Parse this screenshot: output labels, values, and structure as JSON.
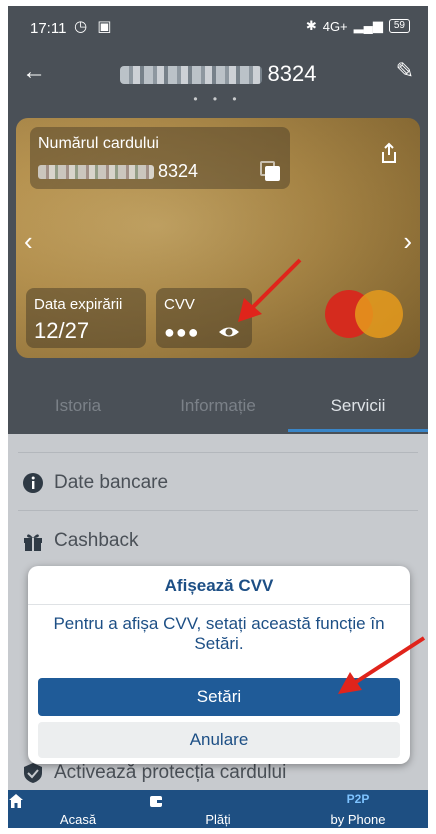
{
  "status_bar": {
    "time": "17:11",
    "battery": "59",
    "network": "4G+"
  },
  "header": {
    "card_last4": "8324"
  },
  "card": {
    "number_label": "Numărul cardului",
    "number_last4": "8324",
    "expiry_label": "Data expirării",
    "expiry_value": "12/27",
    "cvv_label": "CVV",
    "cvv_value": "●●●"
  },
  "tabs": [
    "Istoria",
    "Informație",
    "Servicii"
  ],
  "services": [
    {
      "label": "Date bancare",
      "icon": "info-icon"
    },
    {
      "label": "Cashback",
      "icon": "gift-icon"
    },
    {
      "label": "Activează protecția cardului",
      "icon": "shield-icon"
    }
  ],
  "dialog": {
    "title": "Afișează CVV",
    "message": "Pentru a afișa CVV, setați această funcție în Setări.",
    "primary": "Setări",
    "secondary": "Anulare"
  },
  "nav": {
    "items": [
      {
        "label": "Acasă",
        "icon": "home-icon"
      },
      {
        "label": "Plăți",
        "icon": "wallet-icon"
      },
      {
        "label": "by Phone",
        "badge": "P2P"
      }
    ]
  },
  "colors": {
    "primary": "#1f5b98",
    "nav": "#1e4f82",
    "accent": "#3a86c8",
    "annotation": "#e0241b"
  }
}
